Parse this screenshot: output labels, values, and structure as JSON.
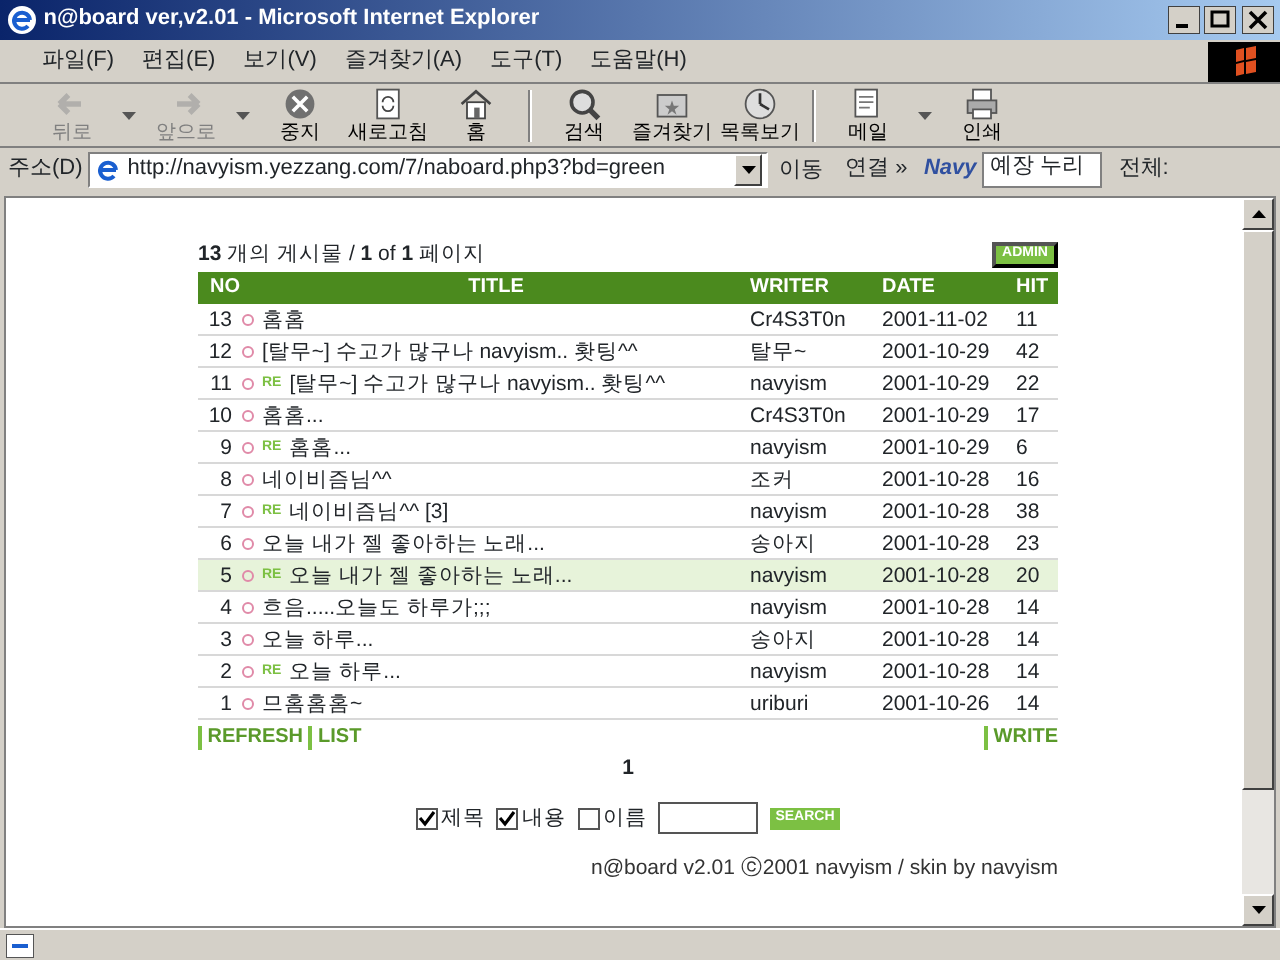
{
  "window": {
    "title": "n@board ver,v2.01 - Microsoft Internet Explorer"
  },
  "menu": [
    "파일(F)",
    "편집(E)",
    "보기(V)",
    "즐겨찾기(A)",
    "도구(T)",
    "도움말(H)"
  ],
  "toolbar": [
    {
      "kind": "back",
      "label": "뒤로",
      "disabled": true,
      "dropdown": true
    },
    {
      "kind": "forward",
      "label": "앞으로",
      "disabled": true,
      "dropdown": true
    },
    {
      "kind": "stop",
      "label": "중지",
      "disabled": false,
      "dropdown": false
    },
    {
      "kind": "refresh",
      "label": "새로고침",
      "disabled": false,
      "dropdown": false
    },
    {
      "kind": "home",
      "label": "홈",
      "disabled": false,
      "dropdown": false
    },
    {
      "kind": "search",
      "label": "검색",
      "disabled": false,
      "dropdown": false
    },
    {
      "kind": "favorites",
      "label": "즐겨찾기",
      "disabled": false,
      "dropdown": false
    },
    {
      "kind": "history",
      "label": "목록보기",
      "disabled": false,
      "dropdown": false
    },
    {
      "kind": "mail",
      "label": "메일",
      "disabled": false,
      "dropdown": true
    },
    {
      "kind": "print",
      "label": "인쇄",
      "disabled": false,
      "dropdown": false
    }
  ],
  "address": {
    "label": "주소(D)",
    "url": "http://navyism.yezzang.com/7/naboard.php3?bd=green",
    "go": "이동",
    "links": "연결 »",
    "navy_logo": "Navy",
    "navy_search": "예장 누리",
    "navy_all": "전체:"
  },
  "board": {
    "summary": "**13** 개의 게시물 / **1** of **1** 페이지",
    "admin": "ADMIN",
    "columns": [
      "NO",
      "TITLE",
      "WRITER",
      "DATE",
      "HIT"
    ],
    "rows": [
      {
        "no": "13",
        "reply": false,
        "title": "홈홈",
        "writer": "Cr4S3T0n",
        "date": "2001-11-02",
        "hit": "11",
        "selected": false
      },
      {
        "no": "12",
        "reply": false,
        "title": "[탈무~] 수고가 많구나 navyism.. 홧팅^^",
        "writer": "탈무~",
        "date": "2001-10-29",
        "hit": "42",
        "selected": false
      },
      {
        "no": "11",
        "reply": "RE",
        "title": "[탈무~] 수고가 많구나 navyism.. 홧팅^^",
        "writer": "navyism",
        "date": "2001-10-29",
        "hit": "22",
        "selected": false
      },
      {
        "no": "10",
        "reply": false,
        "title": "홈홈...",
        "writer": "Cr4S3T0n",
        "date": "2001-10-29",
        "hit": "17",
        "selected": false
      },
      {
        "no": "9",
        "reply": "RE",
        "title": "홈홈...",
        "writer": "navyism",
        "date": "2001-10-29",
        "hit": "6",
        "selected": false
      },
      {
        "no": "8",
        "reply": false,
        "title": "네이비즘님^^",
        "writer": "조커",
        "date": "2001-10-28",
        "hit": "16",
        "selected": false
      },
      {
        "no": "7",
        "reply": "RE",
        "title": "네이비즘님^^ [3]",
        "writer": "navyism",
        "date": "2001-10-28",
        "hit": "38",
        "selected": false
      },
      {
        "no": "6",
        "reply": false,
        "title": "오늘 내가 젤 좋아하는 노래...",
        "writer": "송아지",
        "date": "2001-10-28",
        "hit": "23",
        "selected": false
      },
      {
        "no": "5",
        "reply": "RE",
        "title": "오늘 내가 젤 좋아하는 노래...",
        "writer": "navyism",
        "date": "2001-10-28",
        "hit": "20",
        "selected": true
      },
      {
        "no": "4",
        "reply": false,
        "title": "흐음.....오늘도 하루가;;;",
        "writer": "navyism",
        "date": "2001-10-28",
        "hit": "14",
        "selected": false
      },
      {
        "no": "3",
        "reply": false,
        "title": "오늘 하루...",
        "writer": "송아지",
        "date": "2001-10-28",
        "hit": "14",
        "selected": false
      },
      {
        "no": "2",
        "reply": "RE",
        "title": "오늘 하루...",
        "writer": "navyism",
        "date": "2001-10-28",
        "hit": "14",
        "selected": false
      },
      {
        "no": "1",
        "reply": false,
        "title": "므홈홈홈~",
        "writer": "uriburi",
        "date": "2001-10-26",
        "hit": "14",
        "selected": false
      }
    ],
    "links_left": [
      "REFRESH",
      "LIST"
    ],
    "links_right": [
      "WRITE"
    ],
    "page": "1",
    "search_options": [
      {
        "label": "제목",
        "checked": true
      },
      {
        "label": "내용",
        "checked": true
      },
      {
        "label": "이름",
        "checked": false
      }
    ],
    "search_button": "SEARCH",
    "footer": "n@board v2.01 ⓒ2001 navyism / skin by navyism"
  }
}
